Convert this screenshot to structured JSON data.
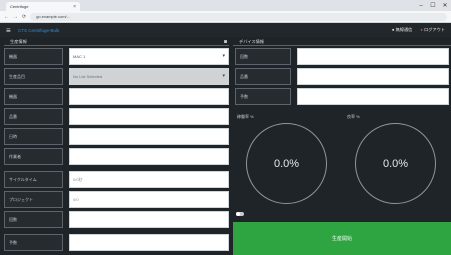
{
  "browser": {
    "tab_title": "Centrifuge",
    "tab_close": "×",
    "url": "go.example.com/...",
    "win_min": "–",
    "win_max": "☐",
    "win_close": "✕"
  },
  "header": {
    "menu_icon": "≡",
    "brand": "CTS Centrifuge-Bulk",
    "status": "● 無線通信",
    "logout": "ログアウト"
  },
  "left_panel": {
    "title": "生産情報",
    "rows": [
      {
        "label": "機器",
        "value": "MAC 1",
        "type": "select"
      },
      {
        "label": "生産品目",
        "value": "No List Selected",
        "type": "select-dim"
      },
      {
        "label": "機器",
        "value": "",
        "type": "text"
      },
      {
        "label": "品番",
        "value": "",
        "type": "text"
      },
      {
        "label": "日時",
        "value": "",
        "type": "text"
      },
      {
        "label": "作業者",
        "value": "",
        "type": "text"
      },
      {
        "label": "サイクルタイム",
        "value": "",
        "placeholder": "0/0秒",
        "type": "text"
      },
      {
        "label": "プロジェクト",
        "value": "",
        "placeholder": "0/0",
        "type": "text"
      },
      {
        "label": "回数",
        "value": "",
        "type": "text"
      },
      {
        "label": "予数",
        "value": "",
        "type": "text"
      }
    ]
  },
  "right_panel": {
    "title": "デバイス情報",
    "rows": [
      {
        "label": "回数",
        "value": ""
      },
      {
        "label": "品番",
        "value": ""
      },
      {
        "label": "予数",
        "value": ""
      }
    ],
    "gauge1_label": "稼働率 %",
    "gauge1_value": "0.0%",
    "gauge2_label": "良率 %",
    "gauge2_value": "0.0%",
    "start_button": "生産開始"
  }
}
